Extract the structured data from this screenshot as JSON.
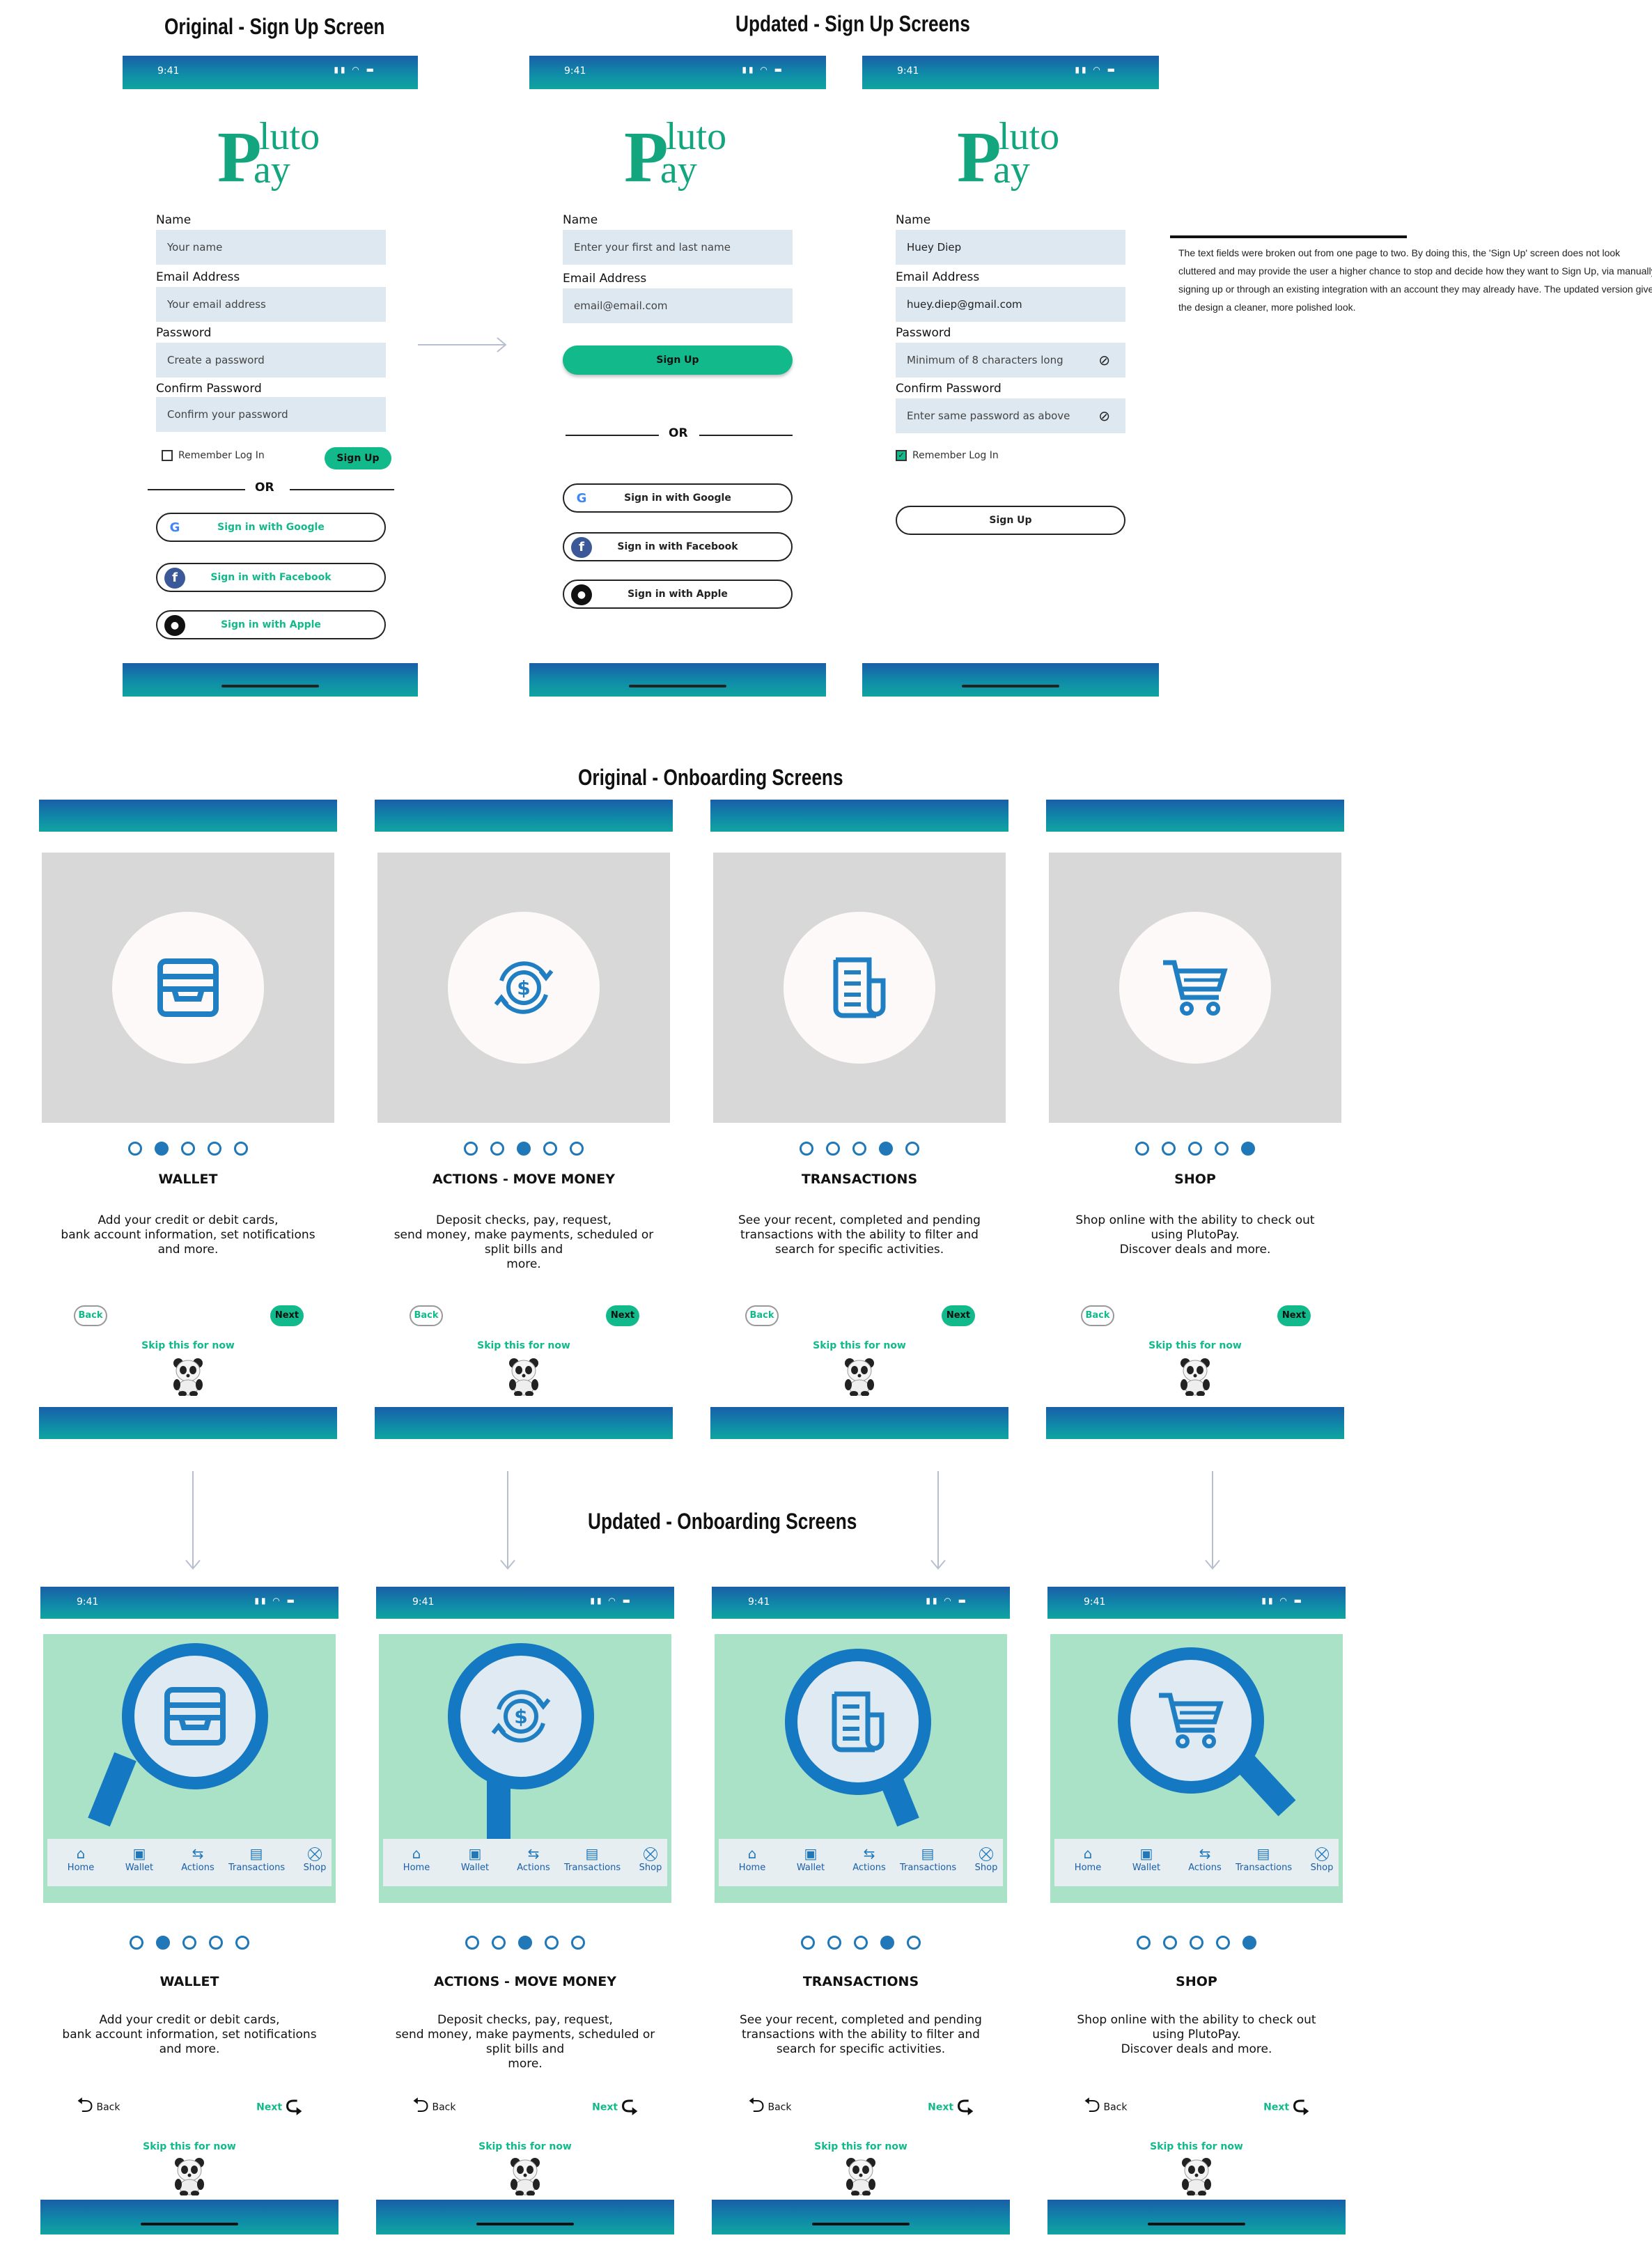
{
  "titles": {
    "original_signup": "Original - Sign Up Screen",
    "updated_signup": "Updated - Sign Up Screens",
    "original_onboarding": "Original - Onboarding Screens",
    "updated_onboarding": "Updated - Onboarding Screens"
  },
  "status_time": "9:41",
  "logo": {
    "p": "P",
    "luto": "luto",
    "ay": "ay"
  },
  "colors": {
    "accent": "#12b98a",
    "brand_blue": "#2078b8",
    "bar_dark": "#1a5ea8",
    "bar_teal": "#11a4a0",
    "field_bg": "#dde8f1",
    "mint": "#a9e2c6"
  },
  "original_signup": {
    "name_label": "Name",
    "name_placeholder": "Your name",
    "email_label": "Email Address",
    "email_placeholder": "Your email address",
    "password_label": "Password",
    "password_placeholder": "Create a password",
    "confirm_label": "Confirm Password",
    "confirm_placeholder": "Confirm your password",
    "remember": "Remember Log In",
    "signup_button": "Sign Up",
    "or": "OR",
    "google": "Sign in with Google",
    "facebook": "Sign in with Facebook",
    "apple": "Sign in with Apple"
  },
  "updated_signup_1": {
    "name_label": "Name",
    "name_placeholder": "Enter your first and last name",
    "email_label": "Email Address",
    "email_placeholder": "email@email.com",
    "signup_button": "Sign Up",
    "or": "OR",
    "google": "Sign in with Google",
    "facebook": "Sign in with Facebook",
    "apple": "Sign in with Apple"
  },
  "updated_signup_2": {
    "name_label": "Name",
    "name_value": "Huey Diep",
    "email_label": "Email Address",
    "email_value": "huey.diep@gmail.com",
    "password_label": "Password",
    "password_placeholder": "Minimum of 8 characters long",
    "confirm_label": "Confirm Password",
    "confirm_placeholder": "Enter same password as above",
    "remember": "Remember Log In",
    "signup_button": "Sign Up"
  },
  "note_lines": [
    "The text fields were broken out from one page to two.  By doing this, the 'Sign Up' screen does not look",
    "cluttered and may provide the user a higher chance to stop and decide how they want to Sign Up, via manually",
    "signing up or through an existing integration with an account they may already have.  The updated version gives",
    "the design a cleaner, more polished look."
  ],
  "onboarding": [
    {
      "heading": "WALLET",
      "icon": "wallet-icon",
      "active_dot": 1,
      "lines": [
        "Add your credit or debit cards,",
        "bank account information, set notifications",
        "and more."
      ]
    },
    {
      "heading": "ACTIONS - MOVE MONEY",
      "icon": "money-exchange-icon",
      "active_dot": 2,
      "lines": [
        "Deposit checks, pay, request,",
        "send money, make payments, scheduled or",
        "split bills and",
        "more."
      ]
    },
    {
      "heading": "TRANSACTIONS",
      "icon": "receipt-icon",
      "active_dot": 3,
      "lines": [
        "See your recent, completed and pending",
        "transactions with the ability to filter and",
        "search for specific activities."
      ]
    },
    {
      "heading": "SHOP",
      "icon": "shopping-cart-icon",
      "active_dot": 4,
      "lines": [
        "Shop online with the ability to check out",
        "using PlutoPay.",
        "Discover deals and more."
      ]
    }
  ],
  "nav": {
    "back": "Back",
    "next": "Next",
    "skip": "Skip this for now"
  },
  "tabs": [
    {
      "label": "Home",
      "icon": "home-icon",
      "glyph": "⌂"
    },
    {
      "label": "Wallet",
      "icon": "wallet-icon",
      "glyph": "▣"
    },
    {
      "label": "Actions",
      "icon": "actions-icon",
      "glyph": "⇆"
    },
    {
      "label": "Transactions",
      "icon": "receipt-icon",
      "glyph": "▤"
    },
    {
      "label": "Shop",
      "icon": "cart-icon",
      "glyph": "⛒"
    }
  ]
}
